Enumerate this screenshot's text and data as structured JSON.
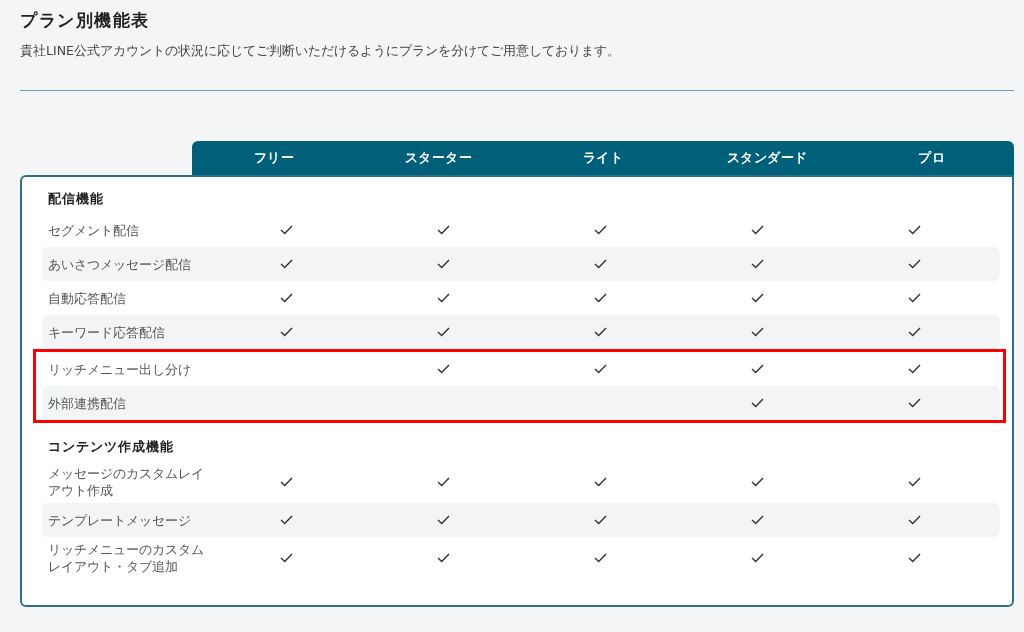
{
  "title": "プラン別機能表",
  "description": "貴社LINE公式アカウントの状況に応じてご判断いただけるようにプランを分けてご用意しております。",
  "plans": [
    "フリー",
    "スターター",
    "ライト",
    "スタンダード",
    "プロ"
  ],
  "sections": [
    {
      "heading": "配信機能",
      "rows": [
        {
          "feature": "セグメント配信",
          "available": [
            true,
            true,
            true,
            true,
            true
          ],
          "highlighted": false
        },
        {
          "feature": "あいさつメッセージ配信",
          "available": [
            true,
            true,
            true,
            true,
            true
          ],
          "highlighted": false
        },
        {
          "feature": "自動応答配信",
          "available": [
            true,
            true,
            true,
            true,
            true
          ],
          "highlighted": false
        },
        {
          "feature": "キーワード応答配信",
          "available": [
            true,
            true,
            true,
            true,
            true
          ],
          "highlighted": false
        },
        {
          "feature": "リッチメニュー出し分け",
          "available": [
            false,
            true,
            true,
            true,
            true
          ],
          "highlighted": true
        },
        {
          "feature": "外部連携配信",
          "available": [
            false,
            false,
            false,
            true,
            true
          ],
          "highlighted": true
        }
      ]
    },
    {
      "heading": "コンテンツ作成機能",
      "rows": [
        {
          "feature": "メッセージのカスタムレイアウト作成",
          "available": [
            true,
            true,
            true,
            true,
            true
          ],
          "highlighted": false
        },
        {
          "feature": "テンプレートメッセージ",
          "available": [
            true,
            true,
            true,
            true,
            true
          ],
          "highlighted": false
        },
        {
          "feature": "リッチメニューのカスタムレイアウト・タブ追加",
          "available": [
            true,
            true,
            true,
            true,
            true
          ],
          "highlighted": false
        }
      ]
    }
  ]
}
